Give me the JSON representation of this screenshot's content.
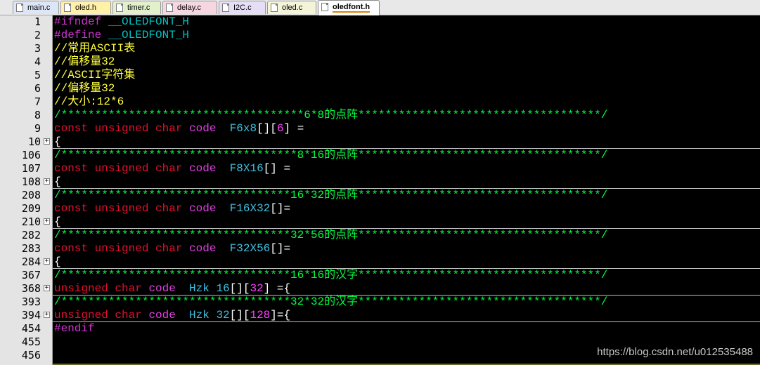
{
  "tabs": [
    {
      "label": "main.c",
      "color": "#dde6f6"
    },
    {
      "label": "oled.h",
      "color": "#fff2a8"
    },
    {
      "label": "timer.c",
      "color": "#e2f0cc"
    },
    {
      "label": "delay.c",
      "color": "#f6d6e0"
    },
    {
      "label": "I2C.c",
      "color": "#e6def6"
    },
    {
      "label": "oled.c",
      "color": "#f4f4d8"
    },
    {
      "label": "oledfont.h",
      "color": "#ffffff"
    }
  ],
  "lines": [
    {
      "n": "1",
      "fold": false,
      "segs": [
        [
          "#ifndef ",
          "c-pre"
        ],
        [
          "__OLEDFONT_H",
          "c-def"
        ]
      ]
    },
    {
      "n": "2",
      "fold": false,
      "segs": [
        [
          "#define ",
          "c-pre"
        ],
        [
          "__OLEDFONT_H",
          "c-def"
        ]
      ]
    },
    {
      "n": "3",
      "fold": false,
      "segs": [
        [
          "//常用ASCII表",
          "c-cmt"
        ]
      ]
    },
    {
      "n": "4",
      "fold": false,
      "segs": [
        [
          "//偏移量32",
          "c-cmt"
        ]
      ]
    },
    {
      "n": "5",
      "fold": false,
      "segs": [
        [
          "//ASCII字符集",
          "c-cmt"
        ]
      ]
    },
    {
      "n": "6",
      "fold": false,
      "segs": [
        [
          "//偏移量32",
          "c-cmt"
        ]
      ]
    },
    {
      "n": "7",
      "fold": false,
      "segs": [
        [
          "//大小:12*6",
          "c-cmt"
        ]
      ]
    },
    {
      "n": "8",
      "fold": false,
      "segs": [
        [
          "/************************************6*8的点阵************************************/",
          "c-star"
        ]
      ]
    },
    {
      "n": "9",
      "fold": false,
      "segs": [
        [
          "const ",
          "c-kw"
        ],
        [
          "unsigned ",
          "c-kw"
        ],
        [
          "char ",
          "c-kw"
        ],
        [
          "code  ",
          "c-ty"
        ],
        [
          "F6x8",
          "c-id"
        ],
        [
          "[][",
          "c-wh"
        ],
        [
          "6",
          "c-num"
        ],
        [
          "] =",
          "c-wh"
        ]
      ]
    },
    {
      "n": "10",
      "fold": true,
      "segs": [
        [
          "{",
          "c-wh"
        ]
      ]
    },
    {
      "n": "106",
      "fold": false,
      "segs": [
        [
          "/***********************************8*16的点阵************************************/",
          "c-star"
        ]
      ]
    },
    {
      "n": "107",
      "fold": false,
      "segs": [
        [
          "const ",
          "c-kw"
        ],
        [
          "unsigned ",
          "c-kw"
        ],
        [
          "char ",
          "c-kw"
        ],
        [
          "code  ",
          "c-ty"
        ],
        [
          "F8X16",
          "c-id"
        ],
        [
          "[] =",
          "c-wh"
        ]
      ]
    },
    {
      "n": "108",
      "fold": true,
      "segs": [
        [
          "{",
          "c-wh"
        ]
      ]
    },
    {
      "n": "208",
      "fold": false,
      "segs": [
        [
          "/**********************************16*32的点阵************************************/",
          "c-star"
        ]
      ]
    },
    {
      "n": "209",
      "fold": false,
      "segs": [
        [
          "const ",
          "c-kw"
        ],
        [
          "unsigned ",
          "c-kw"
        ],
        [
          "char ",
          "c-kw"
        ],
        [
          "code  ",
          "c-ty"
        ],
        [
          "F16X32",
          "c-id"
        ],
        [
          "[]=",
          "c-wh"
        ]
      ]
    },
    {
      "n": "210",
      "fold": true,
      "segs": [
        [
          "{",
          "c-wh"
        ]
      ]
    },
    {
      "n": "282",
      "fold": false,
      "segs": [
        [
          "/**********************************32*56的点阵************************************/",
          "c-star"
        ]
      ]
    },
    {
      "n": "283",
      "fold": false,
      "segs": [
        [
          "const ",
          "c-kw"
        ],
        [
          "unsigned ",
          "c-kw"
        ],
        [
          "char ",
          "c-kw"
        ],
        [
          "code  ",
          "c-ty"
        ],
        [
          "F32X56",
          "c-id"
        ],
        [
          "[]=",
          "c-wh"
        ]
      ]
    },
    {
      "n": "284",
      "fold": true,
      "segs": [
        [
          "{",
          "c-wh"
        ]
      ]
    },
    {
      "n": "367",
      "fold": false,
      "segs": [
        [
          "/**********************************16*16的汉字************************************/",
          "c-star"
        ]
      ]
    },
    {
      "n": "368",
      "fold": true,
      "segs": [
        [
          "unsigned ",
          "c-kw"
        ],
        [
          "char ",
          "c-kw"
        ],
        [
          "code  ",
          "c-ty"
        ],
        [
          "Hzk 16",
          "c-id"
        ],
        [
          "[][",
          "c-wh"
        ],
        [
          "32",
          "c-num"
        ],
        [
          "] ={",
          "c-wh"
        ]
      ]
    },
    {
      "n": "393",
      "fold": false,
      "segs": [
        [
          "/**********************************32*32的汉字************************************/",
          "c-star"
        ]
      ]
    },
    {
      "n": "394",
      "fold": true,
      "segs": [
        [
          "unsigned ",
          "c-kw"
        ],
        [
          "char ",
          "c-kw"
        ],
        [
          "code  ",
          "c-ty"
        ],
        [
          "Hzk 32",
          "c-id"
        ],
        [
          "[][",
          "c-wh"
        ],
        [
          "128",
          "c-num"
        ],
        [
          "]={",
          "c-wh"
        ]
      ]
    },
    {
      "n": "454",
      "fold": false,
      "segs": [
        [
          "#endif",
          "c-pre"
        ]
      ]
    },
    {
      "n": "455",
      "fold": false,
      "segs": []
    },
    {
      "n": "456",
      "fold": false,
      "segs": []
    }
  ],
  "watermark": "https://blog.csdn.net/u012535488"
}
